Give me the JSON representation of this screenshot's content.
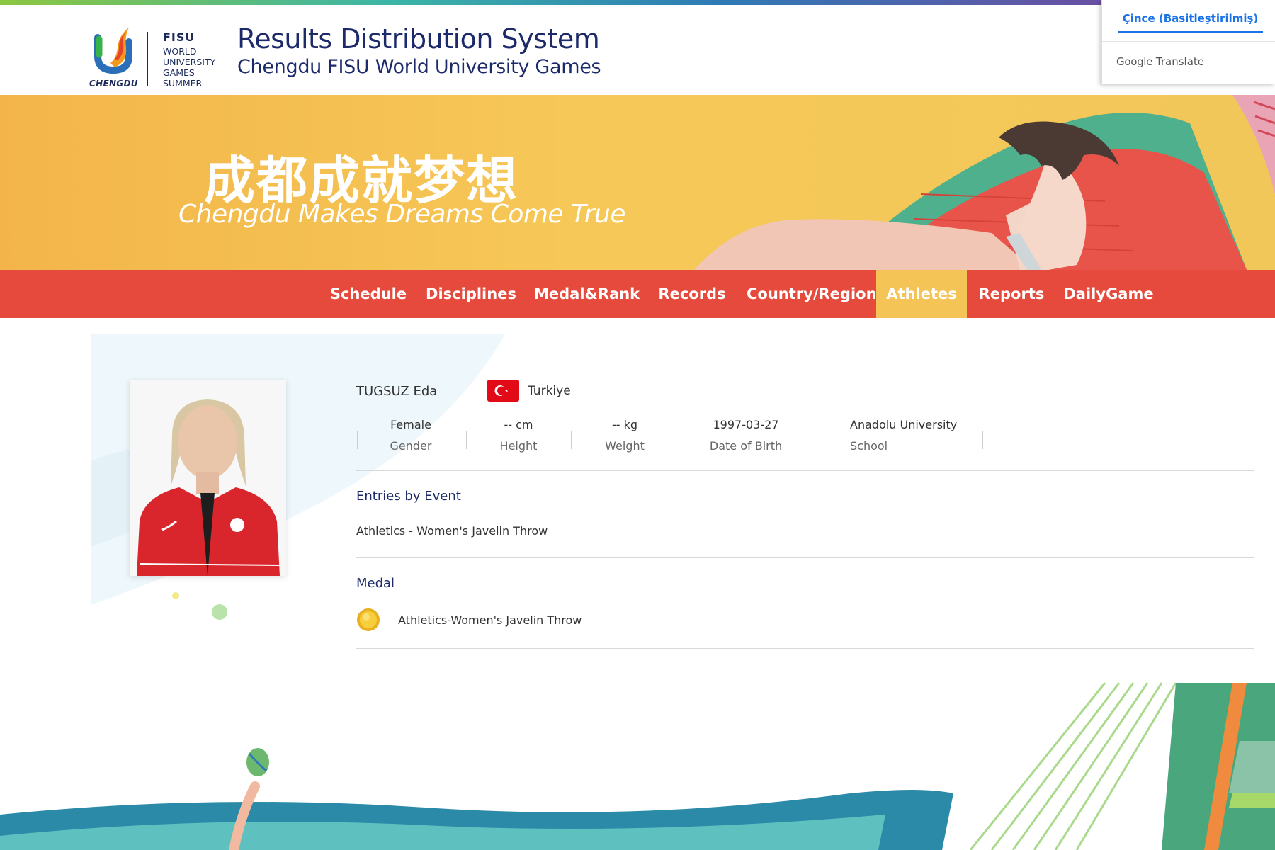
{
  "header": {
    "logo_city": "CHENGDU",
    "logo_fisu": "FISU",
    "logo_lines": [
      "WORLD",
      "UNIVERSITY",
      "GAMES",
      "SUMMER"
    ],
    "title": "Results Distribution System",
    "subtitle": "Chengdu FISU World University Games"
  },
  "translate_popup": {
    "language": "Çince (Basitleştirilmiş)",
    "brand_google": "Google",
    "brand_translate": "Translate"
  },
  "banner": {
    "slogan_cn": "成都成就梦想",
    "slogan_en": "Chengdu Makes Dreams Come True"
  },
  "nav": {
    "items": [
      {
        "label": "Schedule"
      },
      {
        "label": "Disciplines"
      },
      {
        "label": "Medal&Rank"
      },
      {
        "label": "Records"
      },
      {
        "label": "Country/Region"
      },
      {
        "label": "Athletes"
      },
      {
        "label": "Reports"
      },
      {
        "label": "DailyGame"
      }
    ],
    "active": "Athletes"
  },
  "athlete": {
    "name": "TUGSUZ Eda",
    "country": "Turkiye",
    "stats": [
      {
        "value": "Female",
        "label": "Gender"
      },
      {
        "value": "-- cm",
        "label": "Height"
      },
      {
        "value": "-- kg",
        "label": "Weight"
      },
      {
        "value": "1997-03-27",
        "label": "Date of Birth"
      },
      {
        "value": "Anadolu University",
        "label": "School"
      }
    ]
  },
  "entries": {
    "title": "Entries by Event",
    "items": [
      "Athletics - Women's Javelin Throw"
    ]
  },
  "medal": {
    "title": "Medal",
    "items": [
      {
        "type": "gold",
        "event": "Athletics-Women's Javelin Throw"
      }
    ]
  },
  "colors": {
    "nav_bg": "#e54a3c",
    "nav_active": "#f4c457",
    "title": "#1c2a6a",
    "banner": "#f6c857",
    "flag_red": "#e30a17",
    "translate_blue": "#1a73e8"
  }
}
